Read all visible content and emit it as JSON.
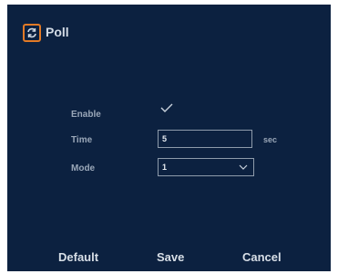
{
  "header": {
    "title": "Poll",
    "icon": "refresh-icon",
    "icon_color": "#e27a26"
  },
  "form": {
    "enable": {
      "label": "Enable",
      "checked": true
    },
    "time": {
      "label": "Time",
      "value": "5",
      "unit": "sec"
    },
    "mode": {
      "label": "Mode",
      "value": "1"
    }
  },
  "buttons": {
    "default_label": "Default",
    "save_label": "Save",
    "cancel_label": "Cancel"
  },
  "colors": {
    "background": "#0c2140",
    "accent": "#e27a26"
  }
}
